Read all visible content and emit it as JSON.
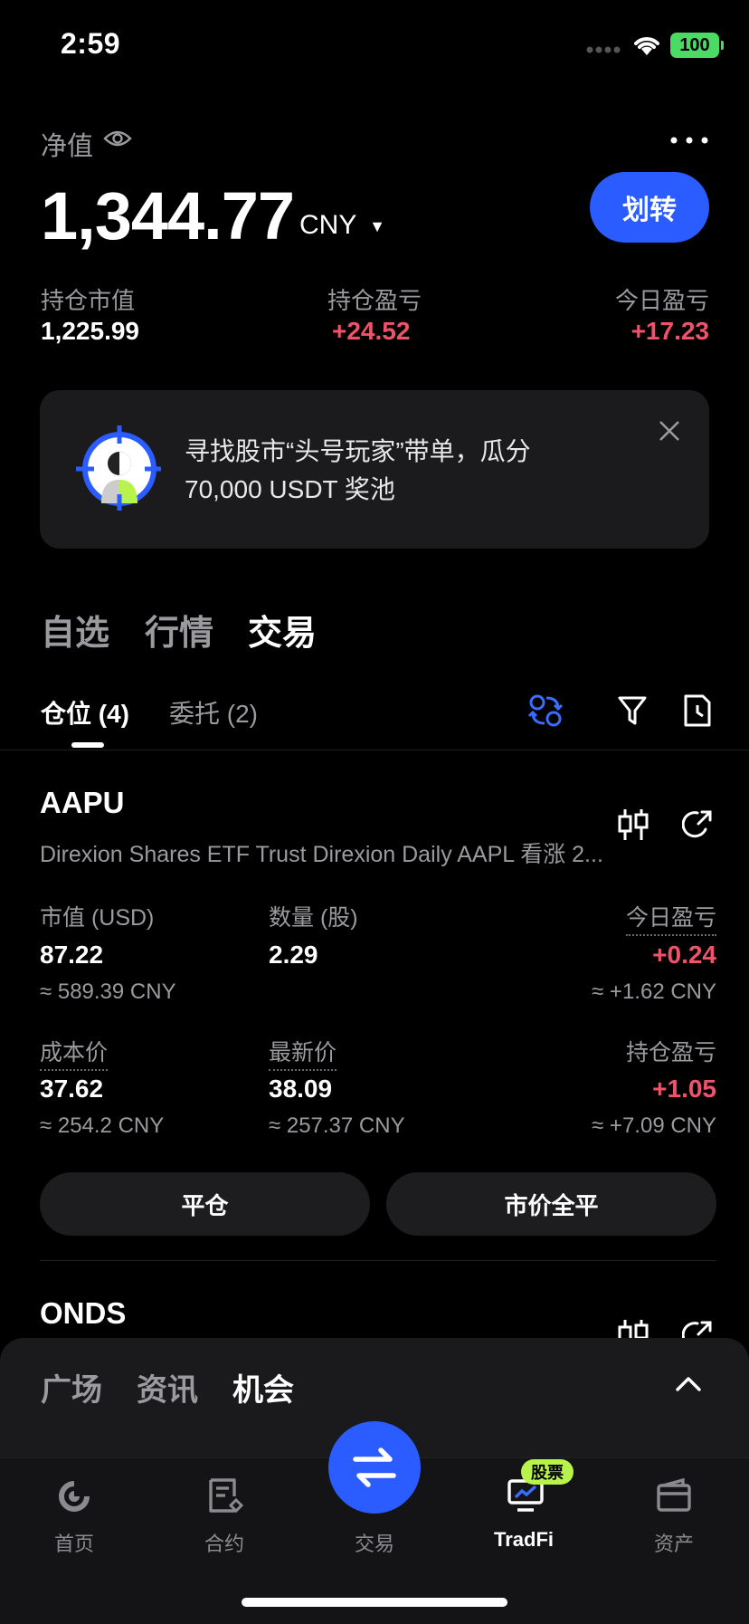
{
  "status_bar": {
    "time": "2:59",
    "battery": "100"
  },
  "header": {
    "net_value_label": "净值",
    "balance": "1,344.77",
    "currency": "CNY",
    "transfer_button": "划转",
    "stats": [
      {
        "label": "持仓市值",
        "value": "1,225.99"
      },
      {
        "label": "持仓盈亏",
        "value": "+24.52"
      },
      {
        "label": "今日盈亏",
        "value": "+17.23"
      }
    ]
  },
  "banner": {
    "line1": "寻找股市“头号玩家”带单，瓜分",
    "line2": "70,000 USDT 奖池"
  },
  "section_tabs": [
    "自选",
    "行情",
    "交易"
  ],
  "sub_tabs": [
    "仓位 (4)",
    "委托 (2)"
  ],
  "positions": [
    {
      "ticker": "AAPU",
      "company": "Direxion Shares ETF Trust Direxion Daily AAPL 看涨 2...",
      "market_value_label": "市值 (USD)",
      "market_value": "87.22",
      "market_value_cny": "≈ 589.39 CNY",
      "quantity_label": "数量 (股)",
      "quantity": "2.29",
      "today_pnl_label": "今日盈亏",
      "today_pnl": "+0.24",
      "today_pnl_cny": "≈ +1.62 CNY",
      "cost_label": "成本价",
      "cost": "37.62",
      "cost_cny": "≈ 254.2 CNY",
      "last_price_label": "最新价",
      "last_price": "38.09",
      "last_price_cny": "≈ 257.37 CNY",
      "position_pnl_label": "持仓盈亏",
      "position_pnl": "+1.05",
      "position_pnl_cny": "≈ +7.09 CNY",
      "close_button": "平仓",
      "market_close_all_button": "市价全平"
    },
    {
      "ticker": "ONDS"
    }
  ],
  "drawer_tabs": [
    "广场",
    "资讯",
    "机会"
  ],
  "tab_bar": {
    "items": [
      "首页",
      "合约",
      "交易",
      "TradFi",
      "资产"
    ],
    "badge": "股票"
  },
  "colors": {
    "accent": "#2a5cff",
    "positive": "#f0526a",
    "badge": "#b8f34b"
  }
}
